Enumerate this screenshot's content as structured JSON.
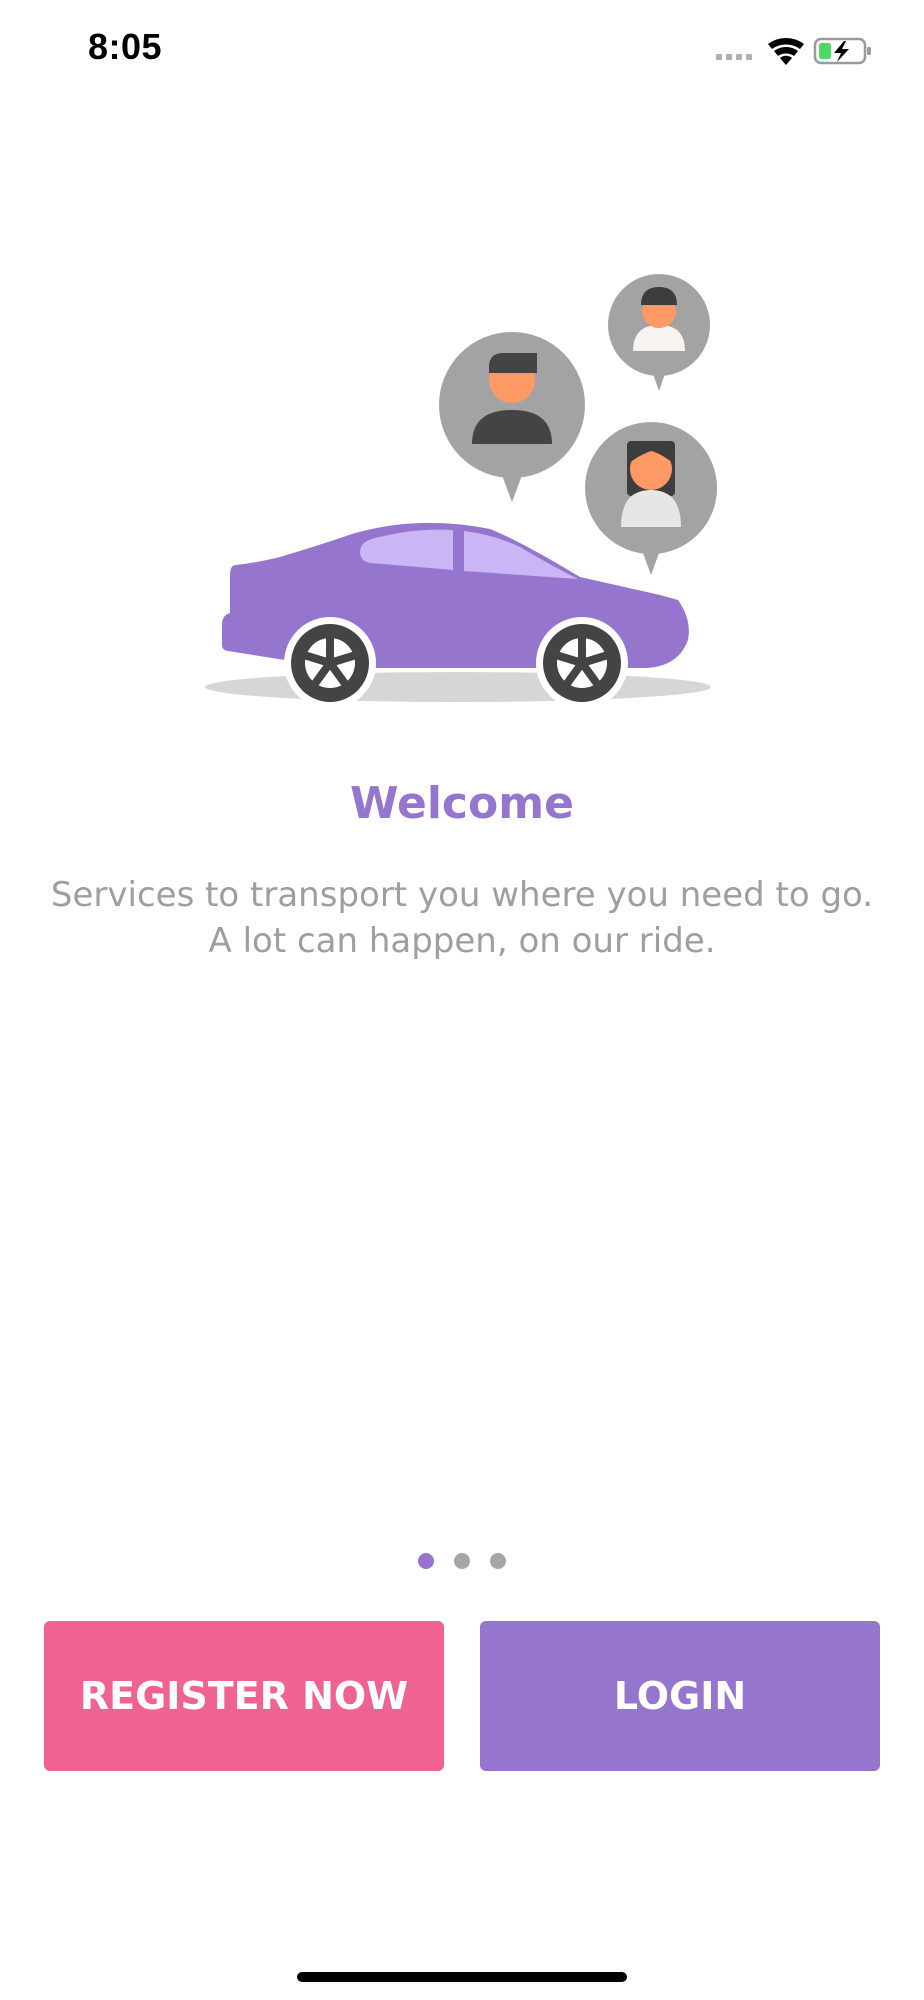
{
  "status_bar": {
    "time": "8:05",
    "icons": [
      "signal-icon",
      "wifi-icon",
      "battery-charging-icon"
    ]
  },
  "onboarding": {
    "title": "Welcome",
    "description": "Services to transport you where you need to go. A lot can happen, on our ride.",
    "page_count": 3,
    "active_page": 1
  },
  "actions": {
    "register_label": "REGISTER NOW",
    "login_label": "LOGIN"
  },
  "colors": {
    "accent": "#9575cd",
    "register": "#f06292",
    "login": "#9575cd",
    "dot_inactive": "#a6a6a6",
    "text_secondary": "#9e9e9e"
  }
}
